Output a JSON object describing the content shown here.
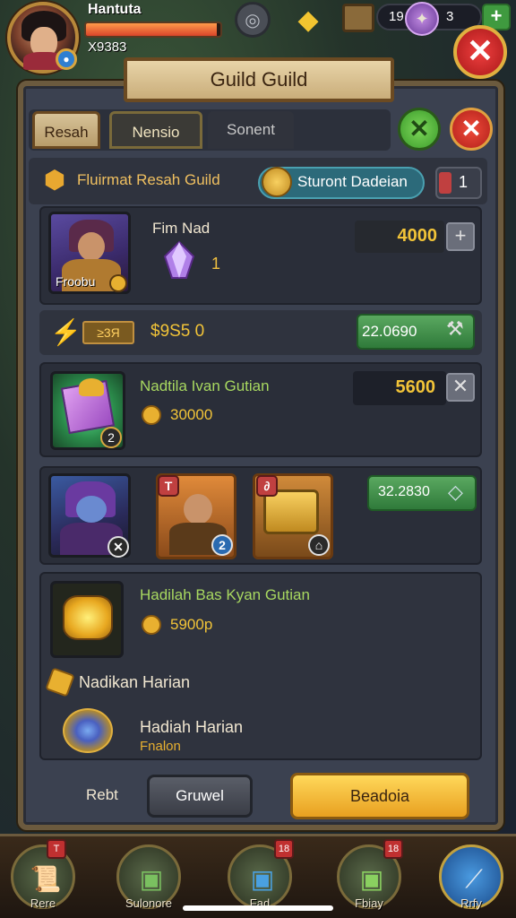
{
  "player": {
    "name": "Hantuta",
    "sub": "X9383",
    "hp_fraction": 0.97
  },
  "hud": {
    "resource1": "19",
    "resource2": "3",
    "plus": "+",
    "close": "✕"
  },
  "guild": {
    "title": "Guild Guild",
    "tabs": [
      "Resah",
      "Nensio",
      "Sonent"
    ],
    "name": "Fluirmat Resah Guild",
    "daily_label": "Sturont Dadeian",
    "count": "1"
  },
  "rewards": [
    {
      "title": "Fim Nad",
      "qty": "1",
      "value": "4000",
      "portrait_label": "Froobu"
    },
    {
      "tag": "≥3Я",
      "amount": "$9S5 0",
      "value": "22.0690"
    },
    {
      "title": "Nadtila Ivan Gutian",
      "amount": "30000",
      "value": "5600",
      "badge": "2"
    },
    {
      "value": "32.2830",
      "badges": [
        "T",
        "2"
      ]
    },
    {
      "title": "Hadilah Bas Kyan Gutian",
      "amount": "5900p"
    }
  ],
  "section": {
    "label": "Nadikan Harian"
  },
  "reward_final": {
    "title": "Hadiah Harian",
    "sub": "Fnalon"
  },
  "footer": {
    "label": "Rebt",
    "btn_secondary": "Gruwel",
    "btn_primary": "Beadoia"
  },
  "nav": [
    {
      "label": "Rere",
      "badge": "T"
    },
    {
      "label": "Sulonore",
      "badge": ""
    },
    {
      "label": "Fad",
      "badge": "18"
    },
    {
      "label": "Fbiay",
      "badge": "18"
    },
    {
      "label": "Rrfy",
      "badge": ""
    }
  ]
}
